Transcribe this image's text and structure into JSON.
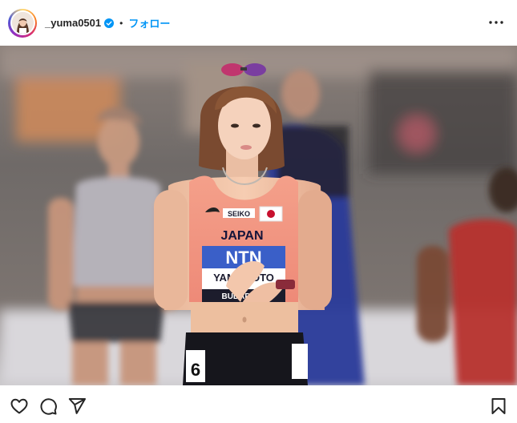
{
  "header": {
    "username": "_yuma0501",
    "separator": "•",
    "follow_label": "フォロー",
    "verified": true
  },
  "photo": {
    "bib_sponsor": "SEIKO",
    "bib_country": "JAPAN",
    "bib_main": "NTN",
    "bib_name": "YAMAMOTO",
    "bib_city": "BUDAPEST",
    "hip_number": "6"
  },
  "icons": {
    "verified": "verified-badge-icon",
    "more": "more-options-icon",
    "like": "heart-icon",
    "comment": "comment-icon",
    "share": "share-icon",
    "save": "bookmark-icon"
  },
  "colors": {
    "accent": "#0095f6",
    "text": "#262626"
  }
}
